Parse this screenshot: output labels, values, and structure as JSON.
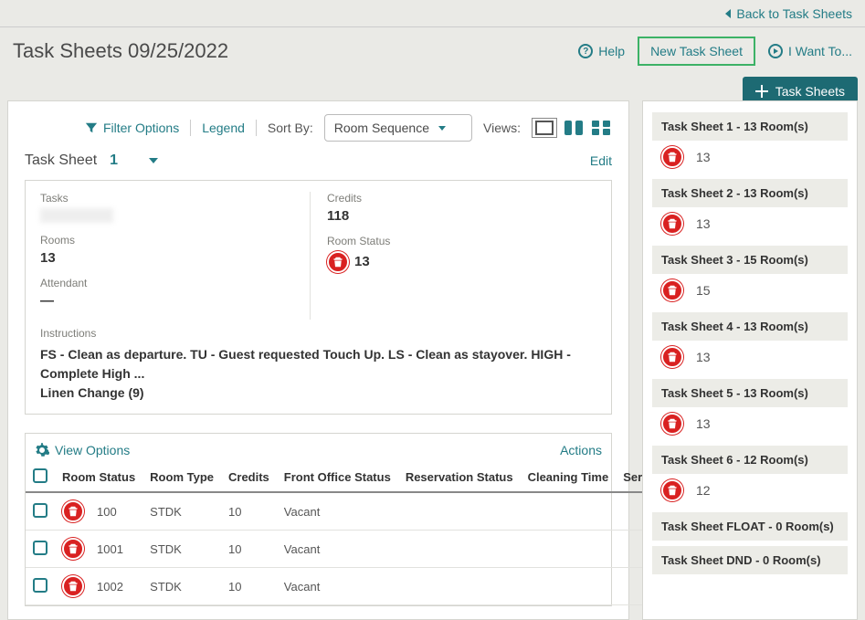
{
  "header": {
    "back_link": "Back to Task Sheets",
    "title": "Task Sheets 09/25/2022",
    "help": "Help",
    "new_task_sheet": "New Task Sheet",
    "i_want_to": "I Want To..."
  },
  "task_sheets_button": "Task Sheets",
  "panel_top": {
    "filter": "Filter Options",
    "legend": "Legend",
    "sort_by_label": "Sort By:",
    "sort_by_value": "Room Sequence",
    "views_label": "Views:"
  },
  "sheet_selector": {
    "label": "Task Sheet",
    "number": "1",
    "edit": "Edit"
  },
  "summary": {
    "tasks_label": "Tasks",
    "rooms_label": "Rooms",
    "rooms_value": "13",
    "attendant_label": "Attendant",
    "attendant_value": "—",
    "credits_label": "Credits",
    "credits_value": "118",
    "room_status_label": "Room Status",
    "room_status_value": "13",
    "instructions_label": "Instructions",
    "instructions_line1": "FS - Clean as departure. TU - Guest requested Touch Up. LS - Clean as stayover. HIGH - Complete High ...",
    "instructions_line2": "Linen Change (9)"
  },
  "table": {
    "view_options": "View Options",
    "actions": "Actions",
    "cols": {
      "room_status": "Room Status",
      "room_type": "Room Type",
      "credits": "Credits",
      "front_office": "Front Office Status",
      "reservation": "Reservation Status",
      "cleaning": "Cleaning Time",
      "ser": "Ser"
    },
    "rows": [
      {
        "room": "100",
        "type": "STDK",
        "credits": "10",
        "fo": "Vacant"
      },
      {
        "room": "1001",
        "type": "STDK",
        "credits": "10",
        "fo": "Vacant"
      },
      {
        "room": "1002",
        "type": "STDK",
        "credits": "10",
        "fo": "Vacant"
      }
    ]
  },
  "sidebar": {
    "items": [
      {
        "title": "Task Sheet 1 - 13 Room(s)",
        "count": "13",
        "body": true
      },
      {
        "title": "Task Sheet 2 - 13 Room(s)",
        "count": "13",
        "body": true
      },
      {
        "title": "Task Sheet 3 - 15 Room(s)",
        "count": "15",
        "body": true
      },
      {
        "title": "Task Sheet 4 - 13 Room(s)",
        "count": "13",
        "body": true
      },
      {
        "title": "Task Sheet 5 - 13 Room(s)",
        "count": "13",
        "body": true
      },
      {
        "title": "Task Sheet 6 - 12 Room(s)",
        "count": "12",
        "body": true
      },
      {
        "title": "Task Sheet FLOAT - 0 Room(s)",
        "count": "",
        "body": false
      },
      {
        "title": "Task Sheet DND - 0 Room(s)",
        "count": "",
        "body": false
      }
    ]
  }
}
